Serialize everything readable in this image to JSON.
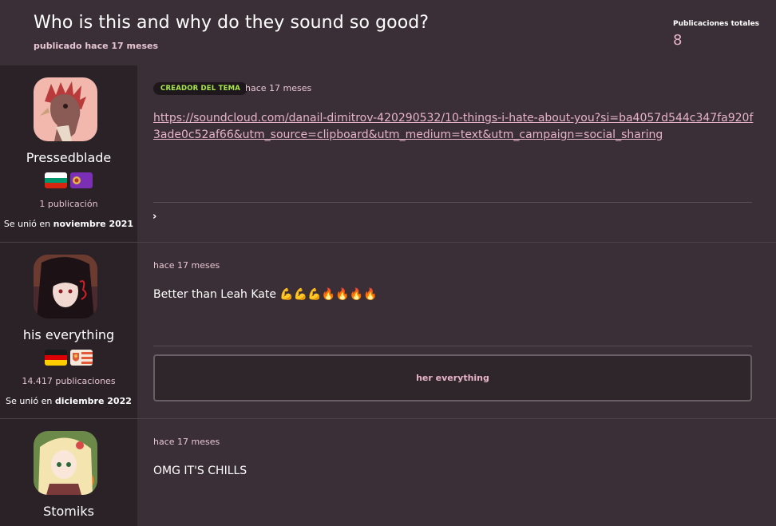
{
  "thread": {
    "title": "Who is this and why do they sound so good?",
    "posted": "publicado hace 17 meses",
    "totals_label": "Publicaciones totales",
    "totals_value": "8"
  },
  "posts": [
    {
      "username": "Pressedblade",
      "post_count": "1 publicación",
      "joined_prefix": "Se unió en ",
      "joined_date": "noviembre 2021",
      "tag": "CREADOR DEL TEMA",
      "time": "hace 17 meses",
      "content": "https://soundcloud.com/danail-dimitrov-420290532/10-things-i-hate-about-you?si=ba4057d544c347fa920f3ade0c52af66&utm_source=clipboard&utm_medium=text&utm_campaign=social_sharing",
      "expand_icon": "chevron-right-icon"
    },
    {
      "username": "his everything",
      "post_count": "14.417 publicaciones",
      "joined_prefix": "Se unió en ",
      "joined_date": "diciembre 2022",
      "time": "hace 17 meses",
      "content": "Better than Leah Kate 💪💪💪🔥🔥🔥🔥",
      "signature": "her everything"
    },
    {
      "username": "Stomiks",
      "time": "hace 17 meses",
      "content": "OMG IT'S CHILLS"
    }
  ],
  "colors": {
    "background": "#3a2f36",
    "sidebar": "#2b2228",
    "accent_pink": "#e7b3c9",
    "tag_green": "#a8e84a"
  }
}
